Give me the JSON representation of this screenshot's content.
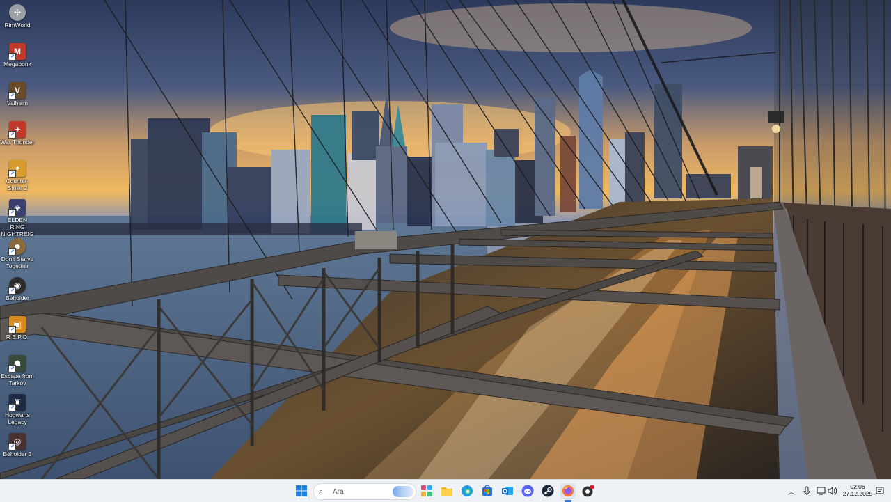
{
  "desktop": {
    "icons": [
      {
        "label": "RimWorld",
        "icon": "rimworld-icon",
        "color": "#9aa0a6"
      },
      {
        "label": "Megabonk",
        "icon": "megabonk-icon",
        "color": "#c0392b"
      },
      {
        "label": "Valheim",
        "icon": "valheim-icon",
        "color": "#6b4a2a"
      },
      {
        "label": "War Thunder",
        "icon": "war-thunder-icon",
        "color": "#c0392b"
      },
      {
        "label": "Counter-Strike 2",
        "icon": "counter-strike-icon",
        "color": "#d89a2a"
      },
      {
        "label": "ELDEN RING NIGHTREIGN",
        "icon": "elden-ring-icon",
        "color": "#3b3f6e"
      },
      {
        "label": "Don't Starve Together",
        "icon": "dont-starve-icon",
        "color": "#8b6b3b"
      },
      {
        "label": "Beholder",
        "icon": "beholder-icon",
        "color": "#2b2b2b"
      },
      {
        "label": "R.E.P.O.",
        "icon": "repo-icon",
        "color": "#d88a1a"
      },
      {
        "label": "Escape from Tarkov",
        "icon": "tarkov-icon",
        "color": "#3a4a3a"
      },
      {
        "label": "Hogwarts Legacy",
        "icon": "hogwarts-icon",
        "color": "#1f2a44"
      },
      {
        "label": "Beholder 3",
        "icon": "beholder3-icon",
        "color": "#4a3030"
      }
    ]
  },
  "taskbar": {
    "search_placeholder": "Ara",
    "pinned": [
      {
        "name": "widgets-icon",
        "color": "#e04a7a"
      },
      {
        "name": "file-explorer-icon",
        "color": "#f2b51c"
      },
      {
        "name": "edge-icon",
        "color": "#1f9be0"
      },
      {
        "name": "store-icon",
        "color": "#2a6fd1"
      },
      {
        "name": "outlook-icon",
        "color": "#1565c0"
      },
      {
        "name": "discord-icon",
        "color": "#5865f2"
      },
      {
        "name": "steam-icon",
        "color": "#1b2838"
      },
      {
        "name": "firefox-icon",
        "color": "#ff7139"
      },
      {
        "name": "obs-icon",
        "color": "#333333"
      }
    ],
    "tray": {
      "time": "02:06",
      "date": "27.12.2025"
    }
  }
}
